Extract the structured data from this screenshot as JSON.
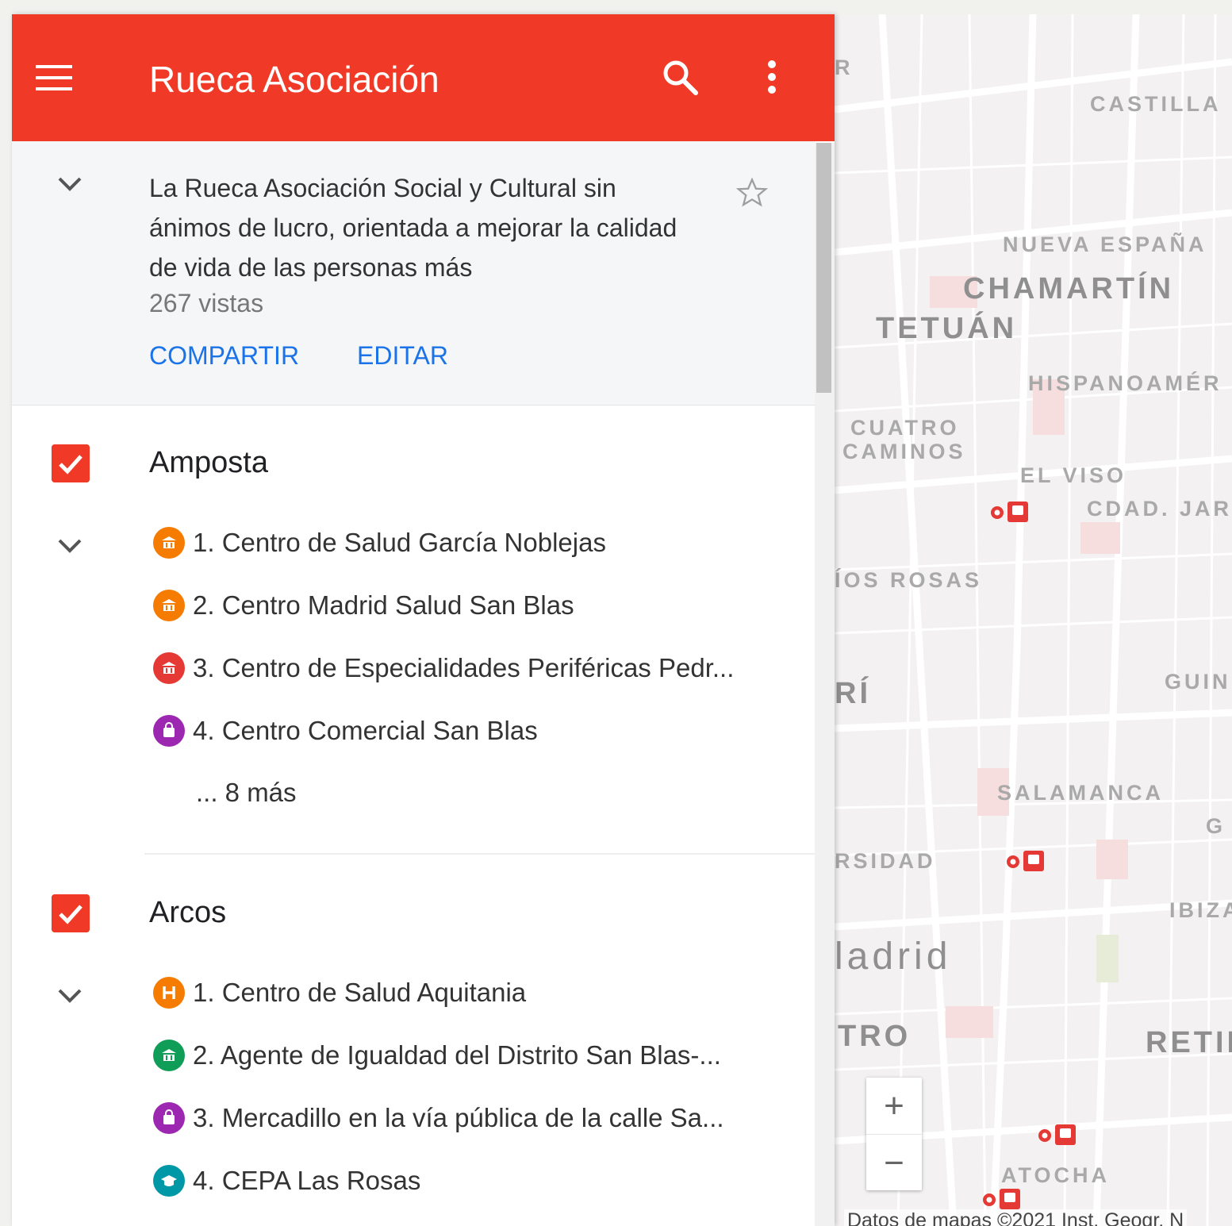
{
  "colors": {
    "header": "#f03a27",
    "accent_blue": "#1a73e8",
    "orange": "#f57c00",
    "red": "#e53935",
    "purple": "#9c27b0",
    "green": "#0f9d58",
    "teal": "#0097a7"
  },
  "header": {
    "title": "Rueca Asociación",
    "menu_icon": "menu-icon",
    "search_icon": "search-icon",
    "more_icon": "more-vert-icon"
  },
  "info": {
    "description": "La Rueca Asociación Social y Cultural sin ánimos de lucro, orientada a mejorar la calidad de vida de las personas más",
    "views": "267 vistas",
    "share_label": "COMPARTIR",
    "edit_label": "EDITAR"
  },
  "layers": [
    {
      "title": "Amposta",
      "checked": true,
      "items": [
        {
          "label": "1. Centro de Salud García Noblejas",
          "icon": "museum-icon",
          "color": "#f57c00"
        },
        {
          "label": "2. Centro Madrid Salud San Blas",
          "icon": "museum-icon",
          "color": "#f57c00"
        },
        {
          "label": "3. Centro de Especialidades Periféricas Pedr...",
          "icon": "museum-icon",
          "color": "#e53935"
        },
        {
          "label": "4. Centro Comercial San Blas",
          "icon": "shopping-bag-icon",
          "color": "#9c27b0"
        }
      ],
      "more": "... 8 más"
    },
    {
      "title": "Arcos",
      "checked": true,
      "items": [
        {
          "label": "1. Centro de Salud Aquitania",
          "icon": "hospital-icon",
          "color": "#f57c00"
        },
        {
          "label": "2. Agente de Igualdad del Distrito San Blas-...",
          "icon": "museum-icon",
          "color": "#0f9d58"
        },
        {
          "label": "3. Mercadillo en la vía pública de la calle Sa...",
          "icon": "shopping-bag-icon",
          "color": "#9c27b0"
        },
        {
          "label": "4. CEPA Las Rosas",
          "icon": "school-icon",
          "color": "#0097a7"
        }
      ]
    }
  ],
  "map": {
    "labels": [
      "R",
      "CASTILLA",
      "NUEVA ESPAÑA",
      "CHAMARTÍN",
      "TETUÁN",
      "HISPANOAMÉR",
      "CUATRO",
      "CAMINOS",
      "EL VISO",
      "CDAD. JAR",
      "ÍOS ROSAS",
      "RÍ",
      "GUIN",
      "SALAMANCA",
      "G",
      "RSIDAD",
      "IBIZA",
      "ladrid",
      "TRO",
      "RETIF",
      "ATOCHA"
    ],
    "zoom_in": "+",
    "zoom_out": "−",
    "attribution": "Datos de mapas ©2021 Inst. Geogr. N"
  }
}
